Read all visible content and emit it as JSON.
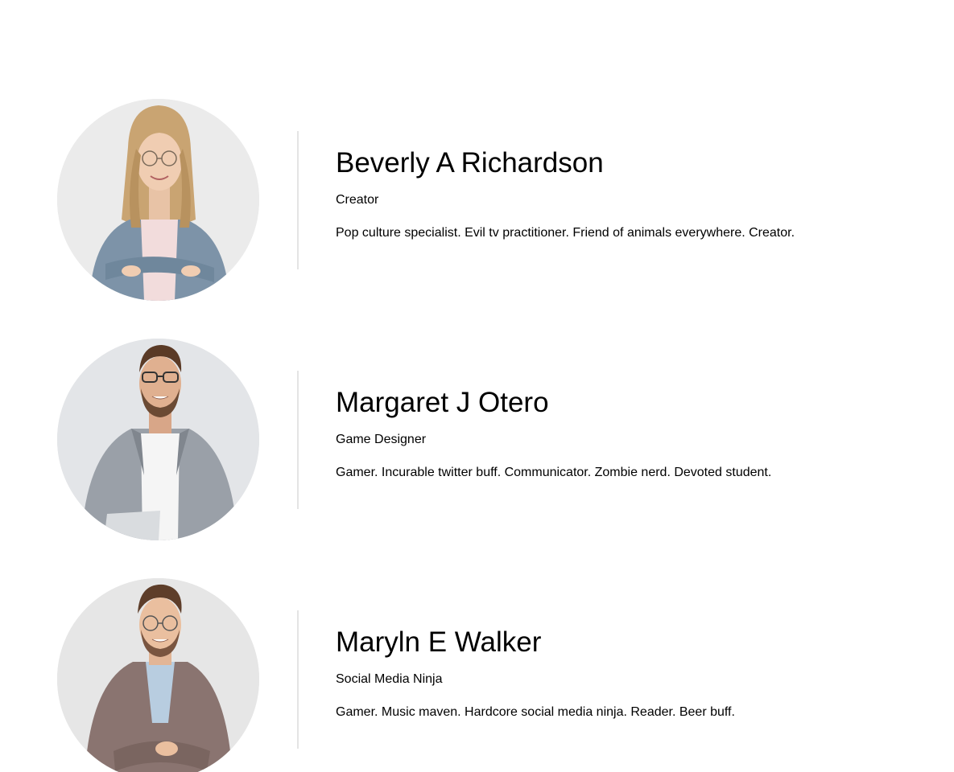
{
  "team": [
    {
      "name": "Beverly A Richardson",
      "role": "Creator",
      "bio": "Pop culture specialist. Evil tv practitioner. Friend of animals everywhere. Creator.",
      "photo": "portrait-woman-denim-jacket"
    },
    {
      "name": "Margaret J Otero",
      "role": "Game Designer",
      "bio": "Gamer. Incurable twitter buff. Communicator. Zombie nerd. Devoted student.",
      "photo": "portrait-man-grey-blazer"
    },
    {
      "name": "Maryln E Walker",
      "role": "Social Media Ninja",
      "bio": "Gamer. Music maven. Hardcore social media ninja. Reader. Beer buff.",
      "photo": "portrait-man-plaid-blazer"
    }
  ]
}
